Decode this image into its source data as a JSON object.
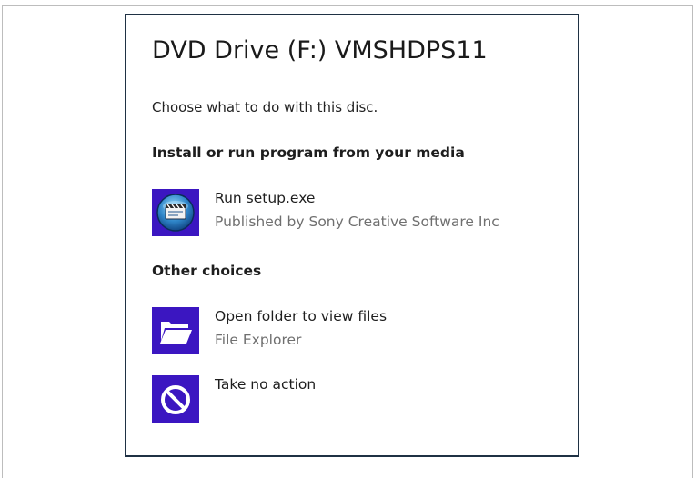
{
  "dialog": {
    "title": "DVD Drive (F:) VMSHDPS11",
    "prompt": "Choose what to do with this disc.",
    "sections": [
      {
        "heading": "Install or run program from your media",
        "options": [
          {
            "label": "Run setup.exe",
            "detail": "Published by Sony Creative Software Inc",
            "icon": "app-disc-icon"
          }
        ]
      },
      {
        "heading": "Other choices",
        "options": [
          {
            "label": "Open folder to view files",
            "detail": "File Explorer",
            "icon": "folder-icon"
          },
          {
            "label": "Take no action",
            "icon": "no-action-icon"
          }
        ]
      }
    ]
  },
  "colors": {
    "tile": "#3b16c1",
    "dialog_border": "#1f3144",
    "secondary_text": "#6f6f6f"
  }
}
